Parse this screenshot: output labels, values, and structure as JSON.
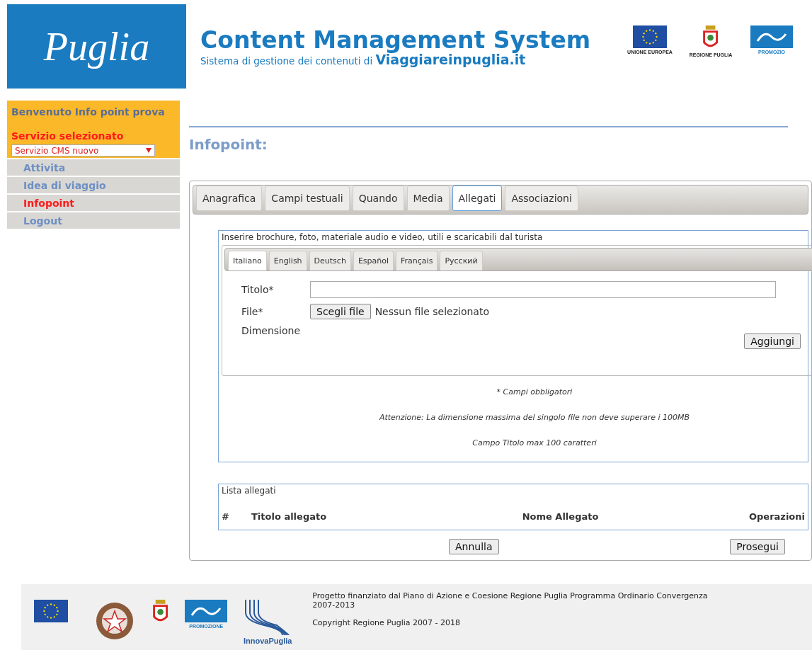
{
  "header": {
    "logo_text": "Puglia",
    "title": "Content Management System",
    "subtitle_prefix": "Sistema di gestione dei contenuti di ",
    "subtitle_site": "Viaggiareinpuglia.it",
    "partner_logos": [
      {
        "kind": "eu",
        "caption": "UNIONE EUROPEA"
      },
      {
        "kind": "region",
        "caption": "REGIONE PUGLIA"
      },
      {
        "kind": "promo",
        "caption": "PROMOZIO"
      }
    ]
  },
  "sidebar": {
    "welcome": "Benvenuto Info point prova",
    "service_label": "Servizio selezionato",
    "service_select": "Servizio CMS nuovo",
    "items": [
      {
        "label": "Attivita",
        "selected": false
      },
      {
        "label": "Idea di viaggio",
        "selected": false
      },
      {
        "label": "Infopoint",
        "selected": true
      },
      {
        "label": "Logout",
        "selected": false
      }
    ]
  },
  "page_title": "Infopoint:",
  "tabs": [
    {
      "label": "Anagrafica",
      "selected": false
    },
    {
      "label": "Campi testuali",
      "selected": false
    },
    {
      "label": "Quando",
      "selected": false
    },
    {
      "label": "Media",
      "selected": false
    },
    {
      "label": "Allegati",
      "selected": true
    },
    {
      "label": "Associazioni",
      "selected": false
    }
  ],
  "upload": {
    "legend": "Inserire brochure, foto, materiale audio e video, utili e scaricabili dal turista",
    "languages": [
      {
        "label": "Italiano",
        "selected": true
      },
      {
        "label": "English",
        "selected": false
      },
      {
        "label": "Deutsch",
        "selected": false
      },
      {
        "label": "Español",
        "selected": false
      },
      {
        "label": "Français",
        "selected": false
      },
      {
        "label": "Русский",
        "selected": false
      }
    ],
    "title_label": "Titolo*",
    "file_label": "File*",
    "file_button": "Scegli file",
    "file_status": "Nessun file selezionato",
    "size_label": "Dimensione",
    "add_button": "Aggiungi",
    "notes": [
      "* Campi obbligatori",
      "Attenzione: La dimensione massima del singolo file non deve superare i 100MB",
      "Campo Titolo max 100 caratteri"
    ]
  },
  "attachments": {
    "legend": "Lista allegati",
    "columns": [
      "#",
      "Titolo allegato",
      "Nome Allegato",
      "Operazioni"
    ]
  },
  "buttons": {
    "cancel": "Annulla",
    "next": "Prosegui"
  },
  "footer": {
    "logos": [
      {
        "kind": "eu"
      },
      {
        "kind": "republic"
      },
      {
        "kind": "region"
      },
      {
        "kind": "promo",
        "caption": "PROMOZIONE"
      },
      {
        "kind": "innova",
        "caption": "InnovaPuglia"
      }
    ],
    "funding": "Progetto finanziato dal Piano di Azione e Coesione Regione Puglia Programma Ordinario Convergenza 2007-2013",
    "copyright": "Copyright Regione Puglia 2007 - 2018"
  }
}
